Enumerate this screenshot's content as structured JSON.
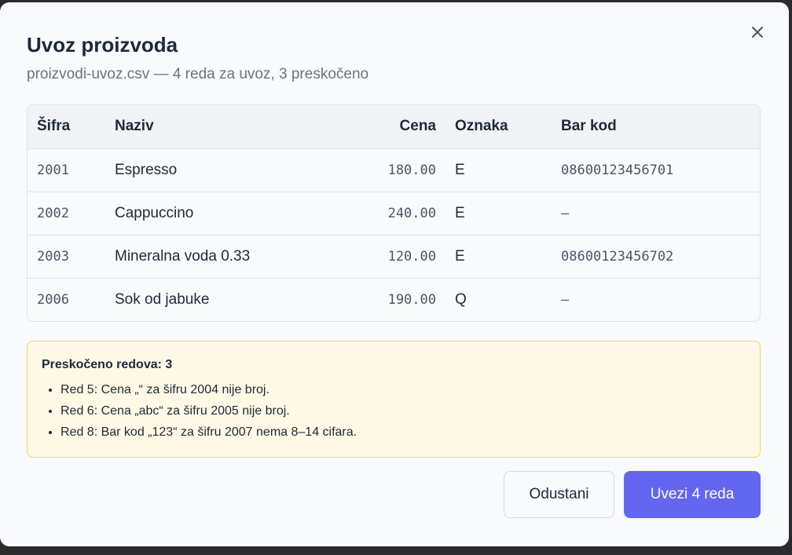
{
  "dialog": {
    "title": "Uvoz proizvoda",
    "subtitle": "proizvodi-uvoz.csv — 4 reda za uvoz, 3 preskočeno"
  },
  "table": {
    "headers": {
      "sku": "Šifra",
      "name": "Naziv",
      "price": "Cena",
      "tag": "Oznaka",
      "barcode": "Bar kod"
    },
    "rows": [
      {
        "sku": "2001",
        "name": "Espresso",
        "price": "180.00",
        "tag": "E",
        "barcode": "08600123456701"
      },
      {
        "sku": "2002",
        "name": "Cappuccino",
        "price": "240.00",
        "tag": "E",
        "barcode": "—"
      },
      {
        "sku": "2003",
        "name": "Mineralna voda 0.33",
        "price": "120.00",
        "tag": "E",
        "barcode": "08600123456702"
      },
      {
        "sku": "2006",
        "name": "Sok od jabuke",
        "price": "190.00",
        "tag": "Q",
        "barcode": "—"
      }
    ]
  },
  "warning": {
    "title": "Preskočeno redova: 3",
    "items": [
      "Red 5: Cena „“ za šifru 2004 nije broj.",
      "Red 6: Cena „abc“ za šifru 2005 nije broj.",
      "Red 8: Bar kod „123“ za šifru 2007 nema 8–14 cifara."
    ]
  },
  "actions": {
    "cancel": "Odustani",
    "confirm": "Uvezi 4 reda"
  },
  "colors": {
    "primary": "#6366f1",
    "warning_bg": "#fef9e6",
    "warning_border": "#f1d46c"
  },
  "icons": {
    "close": "close-icon"
  }
}
